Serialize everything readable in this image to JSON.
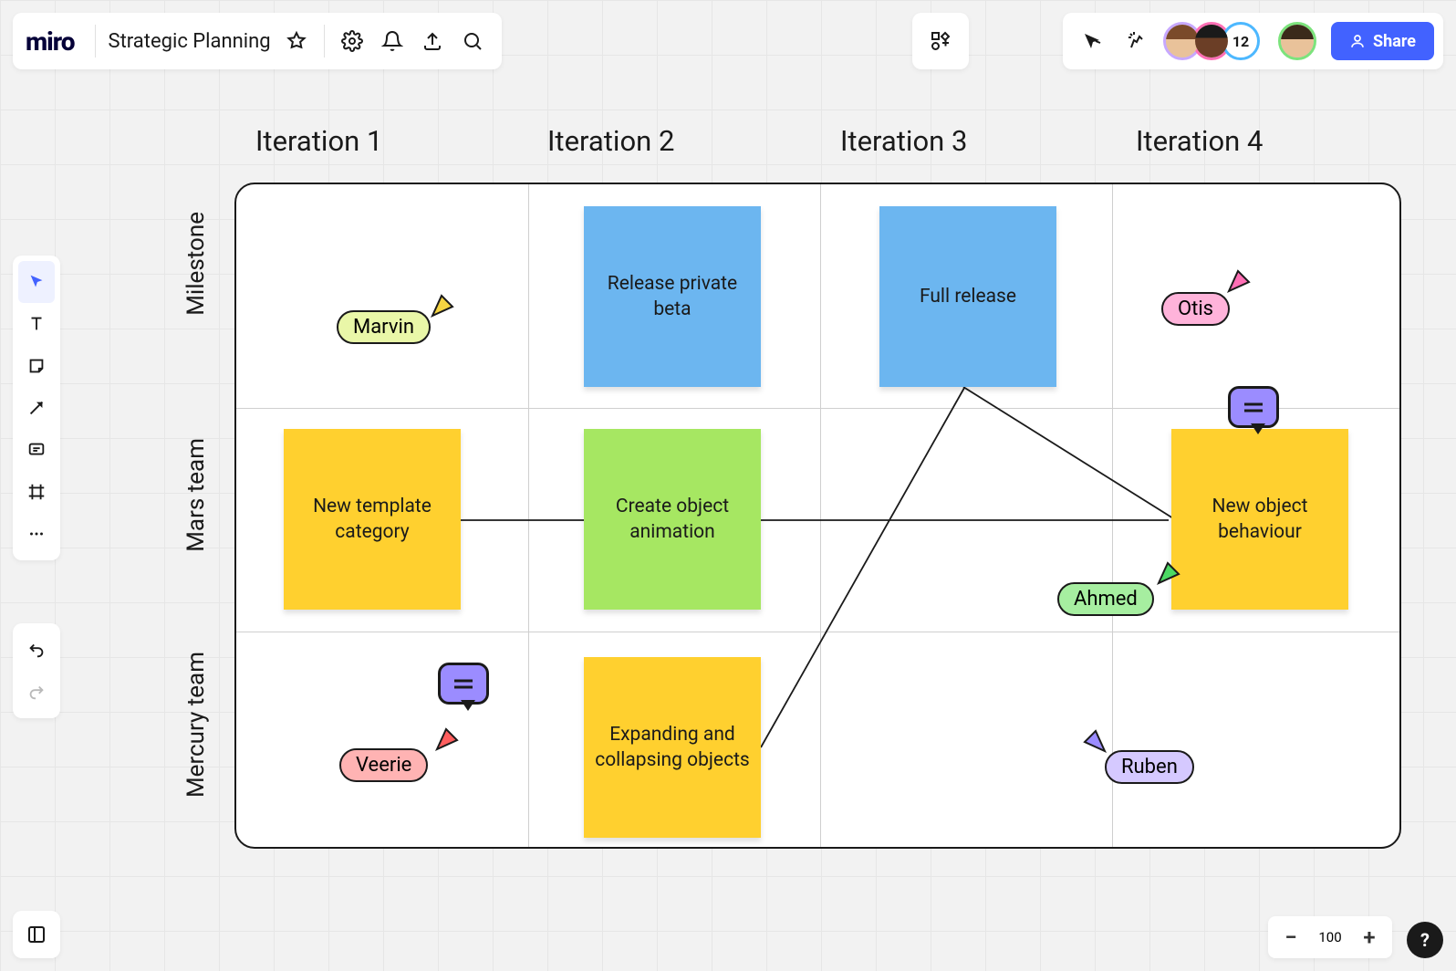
{
  "app": {
    "logo": "miro",
    "board_title": "Strategic Planning"
  },
  "share": {
    "label": "Share",
    "more_count": "12"
  },
  "zoom": {
    "value": "100"
  },
  "columns": [
    "Iteration 1",
    "Iteration 2",
    "Iteration 3",
    "Iteration 4"
  ],
  "rows": [
    "Milestone",
    "Mars team",
    "Mercury team"
  ],
  "stickies": {
    "release_beta": "Release private beta",
    "full_release": "Full release",
    "new_template": "New template category",
    "create_anim": "Create object animation",
    "new_obj_beh": "New object behaviour",
    "expand_collapse": "Expanding and collapsing objects"
  },
  "cursors": {
    "marvin": "Marvin",
    "otis": "Otis",
    "ahmed": "Ahmed",
    "veerie": "Veerie",
    "ruben": "Ruben"
  },
  "colors": {
    "marvin_bg": "#e9f7a8",
    "otis_bg": "#ffb3da",
    "ahmed_bg": "#a6eea0",
    "veerie_bg": "#ffb3b3",
    "ruben_bg": "#d5c9ff",
    "cursor_yellow": "#f5d442",
    "cursor_pink": "#ff6fb5",
    "cursor_green": "#4cd964",
    "cursor_red": "#ff5e5e",
    "cursor_purple": "#9b8cff"
  }
}
